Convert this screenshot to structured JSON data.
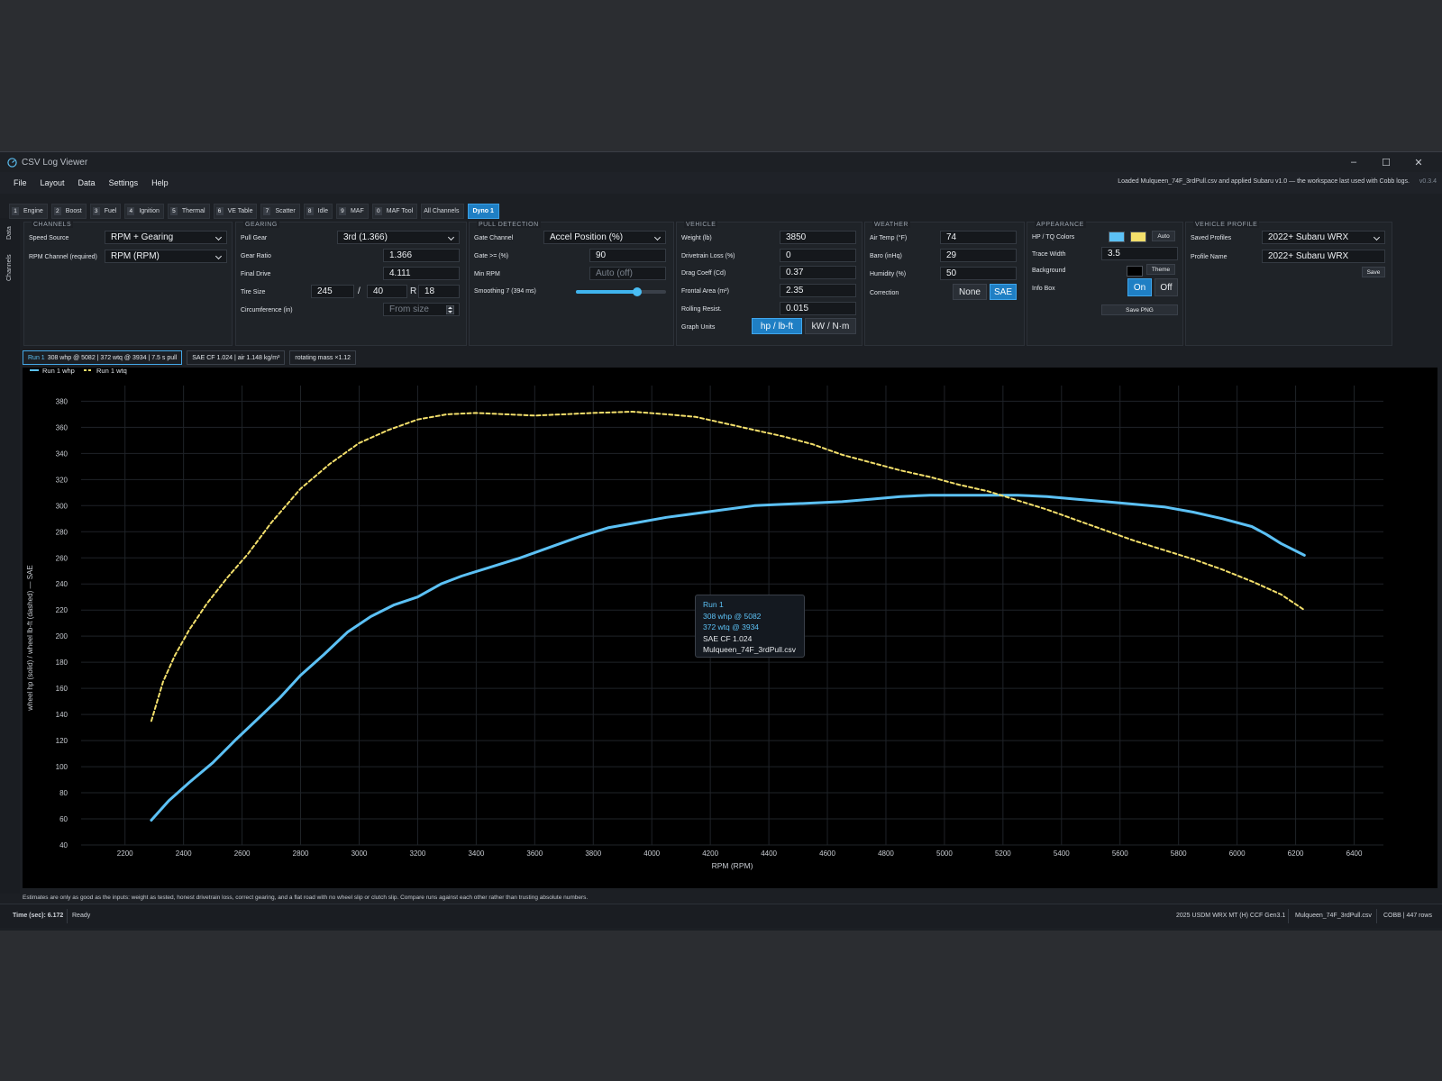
{
  "window": {
    "title": "CSV Log Viewer",
    "controls": [
      "–",
      "☐",
      "✕"
    ]
  },
  "menu": [
    "File",
    "Layout",
    "Data",
    "Settings",
    "Help"
  ],
  "header_status": "Loaded Mulqueen_74F_3rdPull.csv and applied Subaru v1.0 — the workspace last used with Cobb logs.",
  "version": "v0.3.4",
  "tabs": [
    {
      "key": "1",
      "label": "Engine"
    },
    {
      "key": "2",
      "label": "Boost"
    },
    {
      "key": "3",
      "label": "Fuel"
    },
    {
      "key": "4",
      "label": "Ignition"
    },
    {
      "key": "5",
      "label": "Thermal"
    },
    {
      "key": "6",
      "label": "VE Table"
    },
    {
      "key": "7",
      "label": "Scatter"
    },
    {
      "key": "8",
      "label": "Idle"
    },
    {
      "key": "9",
      "label": "MAF"
    },
    {
      "key": "0",
      "label": "MAF Tool"
    },
    {
      "key": "",
      "label": "All Channels"
    },
    {
      "key": "",
      "label": "Dyno 1",
      "active": true
    }
  ],
  "sidebar_tabs": [
    "Data",
    "Channels"
  ],
  "channels": {
    "title": "CHANNELS",
    "speed_source_label": "Speed Source",
    "speed_source": "RPM + Gearing",
    "rpm_channel_label": "RPM Channel (required)",
    "rpm_channel": "RPM (RPM)"
  },
  "gearing": {
    "title": "GEARING",
    "pull_gear_label": "Pull Gear",
    "pull_gear": "3rd (1.366)",
    "gear_ratio_label": "Gear Ratio",
    "gear_ratio": "1.366",
    "final_drive_label": "Final Drive",
    "final_drive": "4.111",
    "tire_size_label": "Tire Size",
    "tire_width": "245",
    "tire_sep": "/",
    "tire_aspect": "40",
    "tire_r": "R",
    "tire_wheel": "18",
    "circ_label": "Circumference (in)",
    "circ_placeholder": "From size"
  },
  "pull": {
    "title": "PULL DETECTION",
    "gate_channel_label": "Gate Channel",
    "gate_channel": "Accel Position (%)",
    "gate_label": "Gate >= (%)",
    "gate": "90",
    "min_rpm_label": "Min RPM",
    "min_rpm_placeholder": "Auto (off)",
    "smoothing_label": "Smoothing 7 (394 ms)",
    "smoothing_level": 0.68
  },
  "vehicle": {
    "title": "VEHICLE",
    "weight_label": "Weight (lb)",
    "weight": "3850",
    "loss_label": "Drivetrain Loss (%)",
    "loss": "0",
    "cd_label": "Drag Coeff (Cd)",
    "cd": "0.37",
    "area_label": "Frontal Area (m²)",
    "area": "2.35",
    "rr_label": "Rolling Resist.",
    "rr": "0.015",
    "units_label": "Graph Units",
    "units_a": "hp / lb-ft",
    "units_b": "kW / N·m"
  },
  "weather": {
    "title": "WEATHER",
    "air_label": "Air Temp (°F)",
    "air": "74",
    "baro_label": "Baro (inHq)",
    "baro": "29",
    "hum_label": "Humidity (%)",
    "hum": "50",
    "corr_label": "Correction",
    "corr_a": "None",
    "corr_b": "SAE"
  },
  "appearance": {
    "title": "APPEARANCE",
    "colors_label": "HP / TQ Colors",
    "hp_color": "#5cc1f5",
    "tq_color": "#f3df6b",
    "auto": "Auto",
    "trace_label": "Trace Width",
    "trace": "3.5",
    "bg_label": "Background",
    "theme": "Theme",
    "info_label": "Info Box",
    "info_on": "On",
    "info_off": "Off",
    "save_png": "Save PNG"
  },
  "profile": {
    "title": "VEHICLE PROFILE",
    "saved_label": "Saved Profiles",
    "saved": "2022+ Subaru WRX",
    "name_label": "Profile Name",
    "name": "2022+ Subaru WRX",
    "save": "Save"
  },
  "info_chips": {
    "run": "Run 1",
    "run_rest": "308 whp @ 5082 | 372 wtq @ 3934 | 7.5 s pull",
    "sae": "SAE CF 1.024 | air 1.148 kg/m³",
    "mass": "rotating mass ×1.12"
  },
  "tooltip": {
    "title": "Run 1",
    "hp": "308 whp @ 5082",
    "tq": "372 wtq @ 3934",
    "cf": "SAE CF 1.024",
    "file": "Mulqueen_74F_3rdPull.csv"
  },
  "chart_data": {
    "type": "line",
    "xlabel": "RPM (RPM)",
    "ylabel": "wheel hp (solid) / wheel lb-ft (dashed) — SAE",
    "xlim": [
      2050,
      6500
    ],
    "ylim": [
      40,
      392
    ],
    "xticks": [
      2200,
      2400,
      2600,
      2800,
      3000,
      3200,
      3400,
      3600,
      3800,
      4000,
      4200,
      4400,
      4600,
      4800,
      5000,
      5200,
      5400,
      5600,
      5800,
      6000,
      6200,
      6400
    ],
    "yticks": [
      40,
      60,
      80,
      100,
      120,
      140,
      160,
      180,
      200,
      220,
      240,
      260,
      280,
      300,
      320,
      340,
      360,
      380
    ],
    "legend": "top-left",
    "series": [
      {
        "name": "Run 1 whp",
        "style": "solid",
        "color": "#5cc1f5",
        "x": [
          2290,
          2350,
          2420,
          2500,
          2580,
          2660,
          2730,
          2800,
          2880,
          2960,
          3040,
          3120,
          3200,
          3280,
          3350,
          3450,
          3550,
          3650,
          3750,
          3850,
          3950,
          4050,
          4150,
          4250,
          4350,
          4450,
          4550,
          4650,
          4750,
          4850,
          4950,
          5050,
          5150,
          5250,
          5350,
          5450,
          5550,
          5650,
          5750,
          5850,
          5950,
          6050,
          6100,
          6150,
          6230
        ],
        "y": [
          59,
          74,
          88,
          103,
          121,
          138,
          153,
          170,
          186,
          203,
          215,
          224,
          230,
          240,
          246,
          253,
          260,
          268,
          276,
          283,
          287,
          291,
          294,
          297,
          300,
          301,
          302,
          303,
          305,
          307,
          308,
          308,
          308,
          308,
          307,
          305,
          303,
          301,
          299,
          295,
          290,
          284,
          278,
          271,
          262
        ]
      },
      {
        "name": "Run 1 wtq",
        "style": "dashed",
        "color": "#f3df6b",
        "x": [
          2290,
          2330,
          2370,
          2420,
          2480,
          2550,
          2620,
          2700,
          2800,
          2900,
          3000,
          3100,
          3200,
          3300,
          3400,
          3500,
          3600,
          3700,
          3800,
          3934,
          4050,
          4150,
          4250,
          4350,
          4450,
          4550,
          4650,
          4750,
          4850,
          4950,
          5050,
          5150,
          5250,
          5350,
          5450,
          5550,
          5650,
          5750,
          5850,
          5950,
          6050,
          6150,
          6230
        ],
        "y": [
          135,
          165,
          185,
          205,
          225,
          245,
          263,
          287,
          313,
          332,
          348,
          358,
          366,
          370,
          371,
          370,
          369,
          370,
          371,
          372,
          370,
          368,
          363,
          358,
          353,
          347,
          339,
          333,
          327,
          322,
          316,
          311,
          304,
          297,
          289,
          281,
          273,
          266,
          259,
          251,
          242,
          232,
          220
        ]
      }
    ]
  },
  "footnote": "Estimates are only as good as the inputs: weight as tested, honest drivetrain loss, correct gearing, and a flat road with no wheel slip or clutch slip. Compare runs against each other rather than trusting absolute numbers.",
  "statusbar": {
    "time": "Time (sec): 6.172",
    "ready": "Ready",
    "car": "2025 USDM WRX MT (H) CCF Gen3.1",
    "file": "Mulqueen_74F_3rdPull.csv",
    "rows": "COBB | 447 rows"
  }
}
